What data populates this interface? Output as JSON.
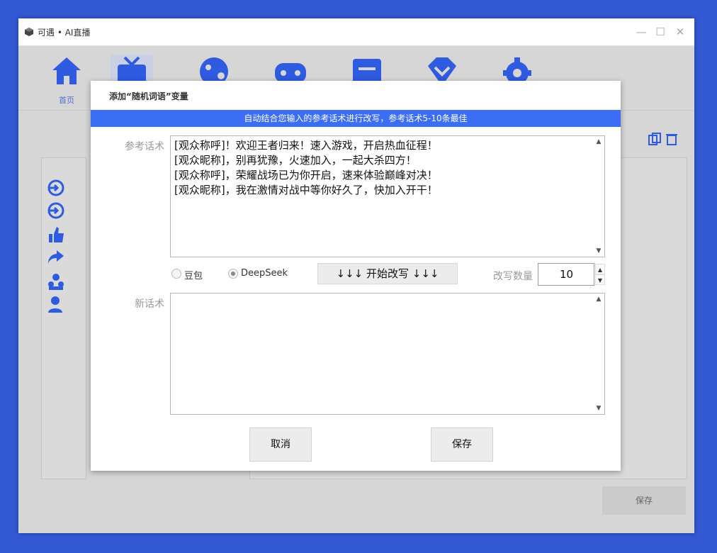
{
  "window": {
    "title": "可遇 • AI直播",
    "minimize_icon": "—",
    "maximize_icon": "☐",
    "close_icon": "✕"
  },
  "toolbar": {
    "items": [
      {
        "icon": "home-icon",
        "label": "首页"
      },
      {
        "icon": "tv-icon",
        "label": ""
      },
      {
        "icon": "palette-icon",
        "label": ""
      },
      {
        "icon": "gamepad-icon",
        "label": ""
      },
      {
        "icon": "message-icon",
        "label": ""
      },
      {
        "icon": "diamond-icon",
        "label": ""
      },
      {
        "icon": "gear-icon",
        "label": ""
      }
    ],
    "icon_color": "#2f5be0"
  },
  "background": {
    "save_label": "保存"
  },
  "dialog": {
    "title": "添加“随机词语”变量",
    "hint": "自动结合您输入的参考话术进行改写，参考话术5-10条最佳",
    "reference_label": "参考话术",
    "reference_lines": [
      "[观众称呼]！欢迎王者归来！速入游戏，开启热血征程！",
      "[观众昵称]，别再犹豫，火速加入，一起大杀四方！",
      "[观众称呼]，荣耀战场已为你开启，速来体验巅峰对决！",
      "[观众昵称]，我在激情对战中等你好久了，快加入开干！"
    ],
    "models": [
      {
        "label": "豆包",
        "checked": false
      },
      {
        "label": "DeepSeek",
        "checked": true
      }
    ],
    "rewrite_button": "↓↓↓ 开始改写 ↓↓↓",
    "count_label": "改写数量",
    "count_value": "10",
    "new_label": "新话术",
    "new_text": "",
    "cancel_button": "取消",
    "save_button": "保存",
    "accent_color": "#3b6ef5"
  }
}
